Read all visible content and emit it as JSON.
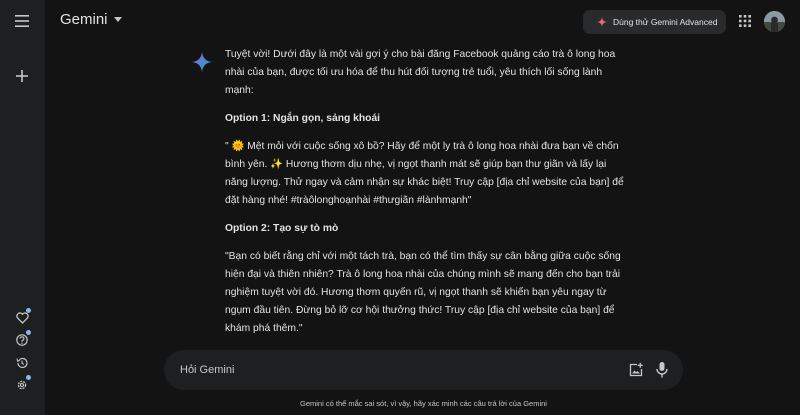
{
  "header": {
    "app_name": "Gemini",
    "upgrade_label": "Dùng thử Gemini Advanced"
  },
  "response": {
    "intro": "Tuyệt vời! Dưới đây là một vài gợi ý cho bài đăng Facebook quảng cáo trà ô long hoa nhài của bạn, được tối ưu hóa để thu hút đối tượng trẻ tuổi, yêu thích lối sống lành mạnh:",
    "option1_heading": "Option 1: Ngắn gọn, sảng khoái",
    "option1_text": "\" 🌞 Mệt mỏi với cuộc sống xô bồ? Hãy để một ly trà ô long hoa nhài đưa bạn về chốn bình yên. ✨ Hương thơm dịu nhẹ, vị ngọt thanh mát sẽ giúp bạn thư giãn và lấy lại năng lượng. Thử ngay và cảm nhận sự khác biệt! Truy cập [địa chỉ website của bạn] để đặt hàng nhé! #tràôlonghoạnhài #thưgiãn #lànhmạnh\"",
    "option2_heading": "Option 2: Tạo sự tò mò",
    "option2_text": "\"Bạn có biết rằng chỉ với một tách trà, bạn có thể tìm thấy sự cân bằng giữa cuộc sống hiện đại và thiên nhiên? Trà ô long hoa nhài của chúng mình sẽ mang đến cho bạn trải nghiệm tuyệt vời đó. Hương thơm quyến rũ, vị ngọt thanh sẽ khiến bạn yêu ngay từ ngụm đầu tiên. Đừng bỏ lỡ cơ hội thưởng thức! Truy cập [địa chỉ website của bạn] để khám phá thêm.\""
  },
  "input": {
    "placeholder": "Hỏi Gemini"
  },
  "footer": {
    "disclaimer": "Gemini có thể mắc sai sót, vì vậy, hãy xác minh các câu trả lời của Gemini"
  },
  "icons": {
    "menu": "menu-icon",
    "new_chat": "plus-icon",
    "gems": "gem-heart-icon",
    "help": "help-icon",
    "activity": "history-icon",
    "settings": "settings-icon",
    "apps": "apps-grid-icon",
    "spark": "gemini-spark-icon",
    "image": "add-image-icon",
    "mic": "mic-icon"
  },
  "colors": {
    "background": "#131314",
    "sidebar": "#1e1f20",
    "notification_dot": "#8ab4f8",
    "spark_blue": "#4b8df8",
    "upgrade_spark": "#e8677d"
  }
}
